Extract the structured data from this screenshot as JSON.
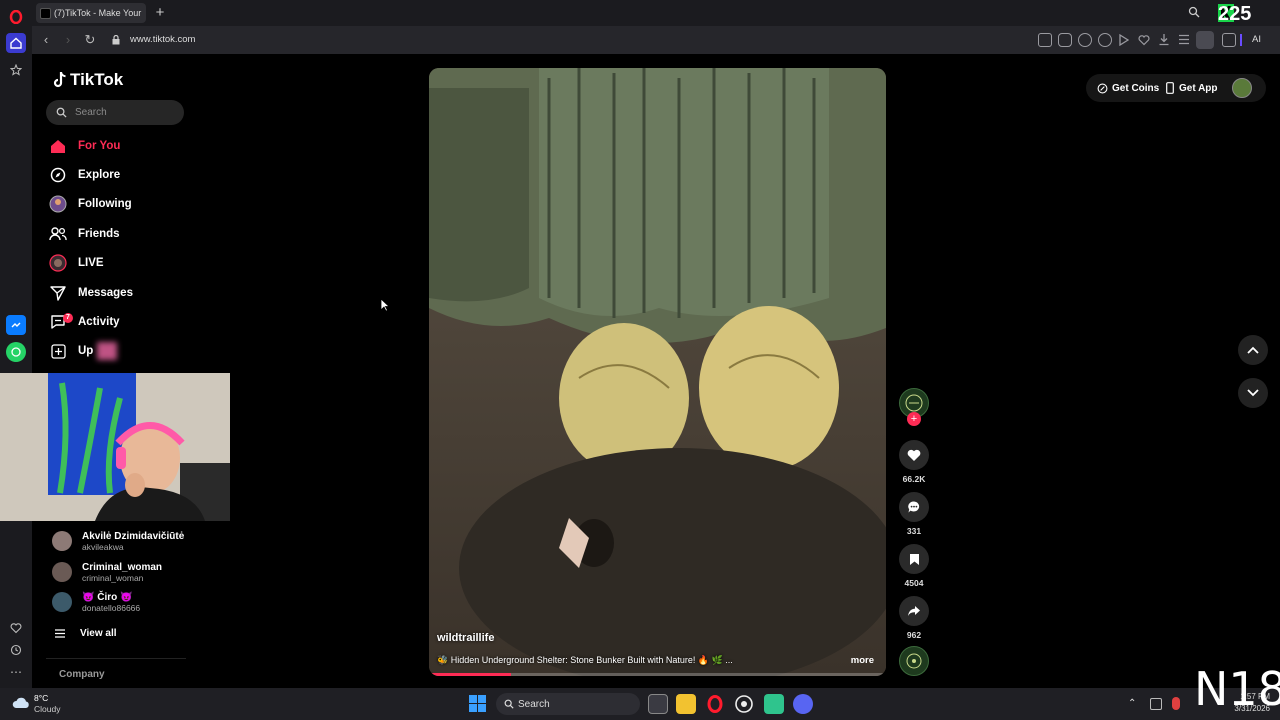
{
  "browser": {
    "tab_title": "(7)TikTok - Make Your",
    "new_tab": "+",
    "url": "www.tiktok.com",
    "toolbar_right_label": "AI"
  },
  "tiktok": {
    "brand": "TikTok",
    "search_placeholder": "Search",
    "nav": [
      {
        "label": "For You",
        "icon": "home-icon"
      },
      {
        "label": "Explore",
        "icon": "compass-icon"
      },
      {
        "label": "Following",
        "icon": "following-avatar-icon"
      },
      {
        "label": "Friends",
        "icon": "friends-icon"
      },
      {
        "label": "LIVE",
        "icon": "live-icon"
      },
      {
        "label": "Messages",
        "icon": "messages-icon"
      },
      {
        "label": "Activity",
        "icon": "activity-icon"
      },
      {
        "label": "Up",
        "icon": "upload-icon"
      }
    ],
    "activity_badge": "7",
    "following_accounts": [
      {
        "name": "Akvilė Dzimidavičiūtė",
        "username": "akvileakwa"
      },
      {
        "name": "Criminal_woman",
        "username": "criminal_woman"
      },
      {
        "name": "😈 Čiro 😈",
        "username": "donatello86666"
      }
    ],
    "view_all": "View all",
    "company": "Company",
    "get_coins": "Get Coins",
    "get_app": "Get App",
    "video": {
      "author": "wildtraillife",
      "caption": "🐝 Hidden Underground Shelter: Stone Bunker Built with Nature! 🔥 🌿 ...",
      "more": "more",
      "progress": 0.18
    },
    "actions": {
      "likes": "66.2K",
      "comments": "331",
      "saves": "4504",
      "shares": "962"
    }
  },
  "taskbar": {
    "weather_temp": "8°C",
    "weather_desc": "Cloudy",
    "search": "Search",
    "clock_time": "1:57 PM",
    "clock_date": "3/31/2026"
  },
  "stream_overlay": {
    "counter": "225",
    "channel": "N18"
  },
  "colors": {
    "accent": "#fe2c55",
    "page_bg": "#000000",
    "browser_chrome": "#1b1b1f"
  }
}
